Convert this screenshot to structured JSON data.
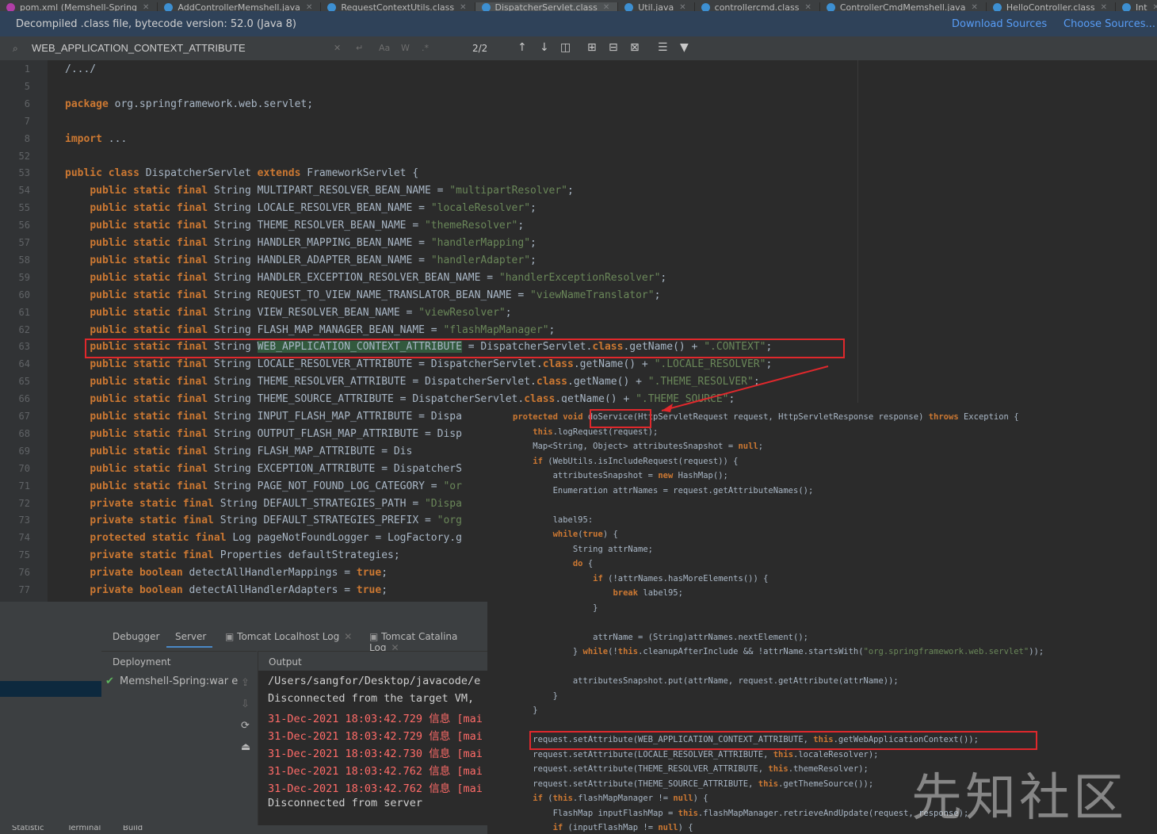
{
  "tabs": [
    {
      "label": "pom.xml (Memshell-Spring"
    },
    {
      "label": "AddControllerMemshell.java"
    },
    {
      "label": "RequestContextUtils.class"
    },
    {
      "label": "DispatcherServlet.class"
    },
    {
      "label": "Util.java"
    },
    {
      "label": "controllercmd.class"
    },
    {
      "label": "ControllerCmdMemshell.java"
    },
    {
      "label": "HelloController.class"
    },
    {
      "label": "Int"
    }
  ],
  "banner": {
    "message": "Decompiled .class file, bytecode version: 52.0 (Java 8)",
    "download_sources": "Download Sources",
    "choose_sources": "Choose Sources..."
  },
  "search": {
    "query": "WEB_APPLICATION_CONTEXT_ATTRIBUTE",
    "match_case": "Aa",
    "words": "W",
    "regex": ".*",
    "match_count": "2/2"
  },
  "editor": {
    "lines": [
      {
        "n": "1",
        "code": "/.../"
      },
      {
        "n": "5",
        "code": ""
      },
      {
        "n": "6",
        "code": "package org.springframework.web.servlet;"
      },
      {
        "n": "7",
        "code": ""
      },
      {
        "n": "8",
        "code": "import ..."
      },
      {
        "n": "52",
        "code": ""
      },
      {
        "n": "53",
        "code": "public class DispatcherServlet extends FrameworkServlet {"
      },
      {
        "n": "54",
        "code": "    public static final String MULTIPART_RESOLVER_BEAN_NAME = \"multipartResolver\";"
      },
      {
        "n": "55",
        "code": "    public static final String LOCALE_RESOLVER_BEAN_NAME = \"localeResolver\";"
      },
      {
        "n": "56",
        "code": "    public static final String THEME_RESOLVER_BEAN_NAME = \"themeResolver\";"
      },
      {
        "n": "57",
        "code": "    public static final String HANDLER_MAPPING_BEAN_NAME = \"handlerMapping\";"
      },
      {
        "n": "58",
        "code": "    public static final String HANDLER_ADAPTER_BEAN_NAME = \"handlerAdapter\";"
      },
      {
        "n": "59",
        "code": "    public static final String HANDLER_EXCEPTION_RESOLVER_BEAN_NAME = \"handlerExceptionResolver\";"
      },
      {
        "n": "60",
        "code": "    public static final String REQUEST_TO_VIEW_NAME_TRANSLATOR_BEAN_NAME = \"viewNameTranslator\";"
      },
      {
        "n": "61",
        "code": "    public static final String VIEW_RESOLVER_BEAN_NAME = \"viewResolver\";"
      },
      {
        "n": "62",
        "code": "    public static final String FLASH_MAP_MANAGER_BEAN_NAME = \"flashMapManager\";"
      },
      {
        "n": "63",
        "code": "    public static final String WEB_APPLICATION_CONTEXT_ATTRIBUTE = DispatcherServlet.class.getName() + \".CONTEXT\";"
      },
      {
        "n": "64",
        "code": "    public static final String LOCALE_RESOLVER_ATTRIBUTE = DispatcherServlet.class.getName() + \".LOCALE_RESOLVER\";"
      },
      {
        "n": "65",
        "code": "    public static final String THEME_RESOLVER_ATTRIBUTE = DispatcherServlet.class.getName() + \".THEME_RESOLVER\";"
      },
      {
        "n": "66",
        "code": "    public static final String THEME_SOURCE_ATTRIBUTE = DispatcherServlet.class.getName() + \".THEME_SOURCE\";"
      },
      {
        "n": "67",
        "code": "    public static final String INPUT_FLASH_MAP_ATTRIBUTE = Dispa"
      },
      {
        "n": "68",
        "code": "    public static final String OUTPUT_FLASH_MAP_ATTRIBUTE = Disp"
      },
      {
        "n": "69",
        "code": "    public static final String FLASH_MAP_ATTRIBUTE = Dis"
      },
      {
        "n": "70",
        "code": "    public static final String EXCEPTION_ATTRIBUTE = DispatcherS"
      },
      {
        "n": "71",
        "code": "    public static final String PAGE_NOT_FOUND_LOG_CATEGORY = \"or"
      },
      {
        "n": "72",
        "code": "    private static final String DEFAULT_STRATEGIES_PATH = \"Dispa"
      },
      {
        "n": "73",
        "code": "    private static final String DEFAULT_STRATEGIES_PREFIX = \"org"
      },
      {
        "n": "74",
        "code": "    protected static final Log pageNotFoundLogger = LogFactory.g"
      },
      {
        "n": "75",
        "code": "    private static final Properties defaultStrategies;"
      },
      {
        "n": "76",
        "code": "    private boolean detectAllHandlerMappings = true;"
      },
      {
        "n": "77",
        "code": "    private boolean detectAllHandlerAdapters = true;"
      }
    ]
  },
  "debug": {
    "tabs": {
      "debugger": "Debugger",
      "server": "Server",
      "tomcat_localhost": "Tomcat Localhost Log",
      "tomcat_catalina": "Tomcat Catalina Log"
    },
    "deployment_header": "Deployment",
    "output_header": "Output",
    "deployment_item": "Memshell-Spring:war e",
    "output_lines": [
      {
        "text": "/Users/sangfor/Desktop/javacode/e",
        "kind": "normal"
      },
      {
        "text": "Disconnected from the target VM,",
        "kind": "normal"
      },
      {
        "text": "31-Dec-2021 18:03:42.729 信息 [mai",
        "kind": "error"
      },
      {
        "text": "31-Dec-2021 18:03:42.729 信息 [mai",
        "kind": "error"
      },
      {
        "text": "31-Dec-2021 18:03:42.730 信息 [mai",
        "kind": "error"
      },
      {
        "text": "31-Dec-2021 18:03:42.762 信息 [mai",
        "kind": "error"
      },
      {
        "text": "31-Dec-2021 18:03:42.762 信息 [mai",
        "kind": "error"
      },
      {
        "text": "Disconnected from server",
        "kind": "normal"
      }
    ],
    "bottom_bar": [
      "Statistic",
      "Terminal",
      "Build"
    ]
  },
  "overlay": {
    "lines": [
      "protected void doService(HttpServletRequest request, HttpServletResponse response) throws Exception {",
      "    this.logRequest(request);",
      "    Map<String, Object> attributesSnapshot = null;",
      "    if (WebUtils.isIncludeRequest(request)) {",
      "        attributesSnapshot = new HashMap();",
      "        Enumeration attrNames = request.getAttributeNames();",
      "",
      "        label95:",
      "        while(true) {",
      "            String attrName;",
      "            do {",
      "                if (!attrNames.hasMoreElements()) {",
      "                    break label95;",
      "                }",
      "",
      "                attrName = (String)attrNames.nextElement();",
      "            } while(!this.cleanupAfterInclude && !attrName.startsWith(\"org.springframework.web.servlet\"));",
      "",
      "            attributesSnapshot.put(attrName, request.getAttribute(attrName));",
      "        }",
      "    }",
      "",
      "    request.setAttribute(WEB_APPLICATION_CONTEXT_ATTRIBUTE, this.getWebApplicationContext());",
      "    request.setAttribute(LOCALE_RESOLVER_ATTRIBUTE, this.localeResolver);",
      "    request.setAttribute(THEME_RESOLVER_ATTRIBUTE, this.themeResolver);",
      "    request.setAttribute(THEME_SOURCE_ATTRIBUTE, this.getThemeSource());",
      "    if (this.flashMapManager != null) {",
      "        FlashMap inputFlashMap = this.flashMapManager.retrieveAndUpdate(request, response);",
      "        if (inputFlashMap != null) {"
    ]
  },
  "watermark": "先知社区",
  "colors": {
    "keyword": "#cc7832",
    "string": "#6a8759",
    "text": "#a9b7c6",
    "highlight": "#e0282c",
    "link": "#589df6"
  }
}
